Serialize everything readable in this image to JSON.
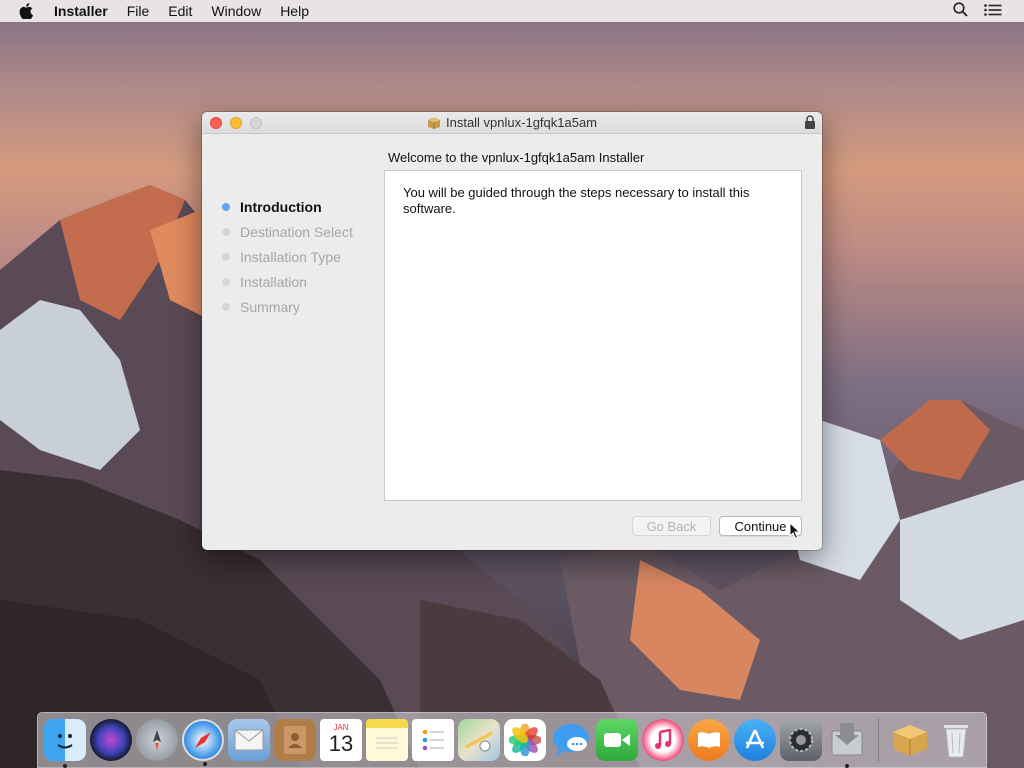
{
  "menubar": {
    "app_name": "Installer",
    "items": [
      "File",
      "Edit",
      "Window",
      "Help"
    ]
  },
  "window": {
    "title": "Install vpnlux-1gfqk1a5am",
    "subtitle": "Welcome to the vpnlux-1gfqk1a5am Installer",
    "steps": [
      {
        "label": "Introduction",
        "active": true
      },
      {
        "label": "Destination Select",
        "active": false
      },
      {
        "label": "Installation Type",
        "active": false
      },
      {
        "label": "Installation",
        "active": false
      },
      {
        "label": "Summary",
        "active": false
      }
    ],
    "body_text": "You will be guided through the steps necessary to install this software.",
    "go_back_label": "Go Back",
    "continue_label": "Continue"
  },
  "dock": {
    "calendar_month": "JAN",
    "calendar_day": "13",
    "items": [
      "finder-icon",
      "siri-icon",
      "launchpad-icon",
      "safari-icon",
      "mail-icon",
      "contacts-icon",
      "calendar-icon",
      "notes-icon",
      "reminders-icon",
      "maps-icon",
      "photos-icon",
      "messages-icon",
      "facetime-icon",
      "itunes-icon",
      "ibooks-icon",
      "app-store-icon",
      "system-preferences-icon",
      "installer-icon",
      "package-icon",
      "trash-icon"
    ]
  },
  "colors": {
    "active_step_dot": "#5fa6ef",
    "close": "#fc5f57",
    "minimize": "#fdbc2e"
  }
}
